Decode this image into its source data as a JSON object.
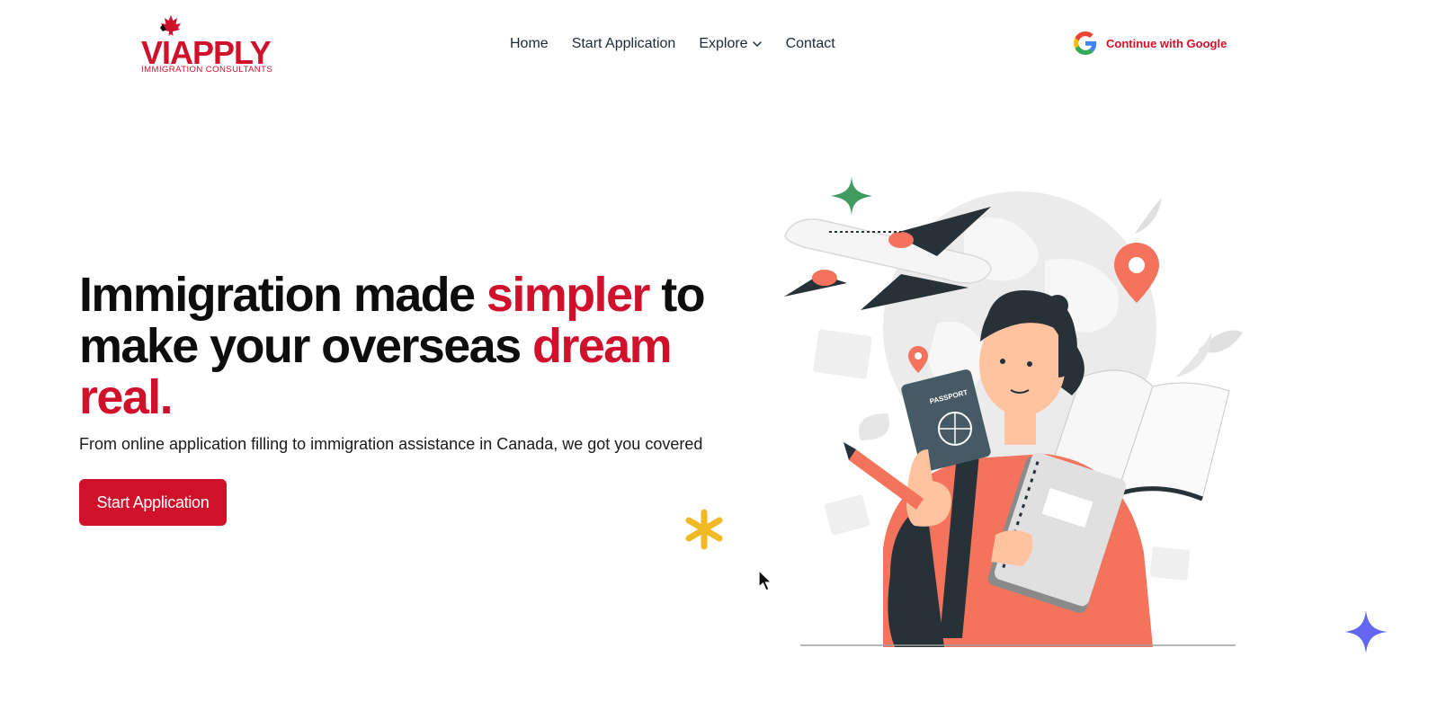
{
  "header": {
    "logo_text": "VIAPPLY",
    "logo_tagline": "IMMIGRATION CONSULTANTS",
    "nav": [
      {
        "label": "Home",
        "icon": null
      },
      {
        "label": "Start Application",
        "icon": null
      },
      {
        "label": "Explore",
        "icon": "chevron-down-icon"
      },
      {
        "label": "Contact",
        "icon": null
      }
    ],
    "google_button_label": "Continue with Google"
  },
  "hero": {
    "title": {
      "part1": "Immigration made ",
      "accent1": "simpler",
      "part2": " to make your overseas ",
      "accent2": "dream real."
    },
    "subtitle": "From online application filling to immigration assistance in Canada, we got you covered",
    "cta_label": "Start Application",
    "illustration": {
      "passport_label": "PASSPORT"
    }
  },
  "colors": {
    "brand_red": "#d0112b",
    "text_dark": "#0d0d0d",
    "illustration_coral": "#f4735c",
    "illustration_dark": "#263238",
    "decor_green": "#3f9b5f",
    "decor_yellow": "#f2b926",
    "decor_purple": "#6266f1"
  },
  "decorations": [
    "green-sparkle-icon",
    "yellow-asterisk-icon",
    "purple-sparkle-icon",
    "mouse-cursor-icon"
  ]
}
